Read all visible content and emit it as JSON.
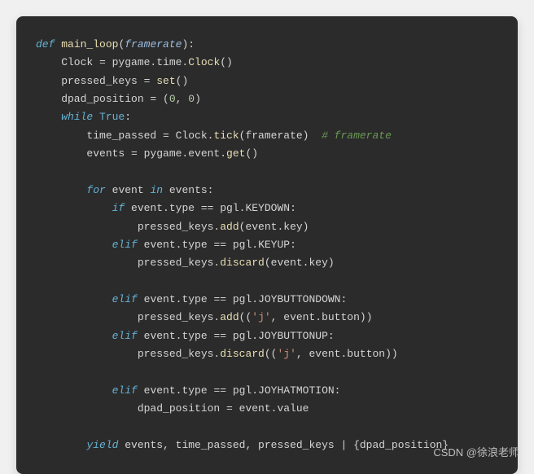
{
  "code": {
    "lines": [
      [
        {
          "t": "def ",
          "c": "kw"
        },
        {
          "t": "main_loop",
          "c": "fn"
        },
        {
          "t": "(",
          "c": "punct"
        },
        {
          "t": "framerate",
          "c": "param"
        },
        {
          "t": "):",
          "c": "punct"
        }
      ],
      [
        {
          "t": "    Clock = pygame.time.",
          "c": "attr"
        },
        {
          "t": "Clock",
          "c": "fn"
        },
        {
          "t": "()",
          "c": "punct"
        }
      ],
      [
        {
          "t": "    pressed_keys = ",
          "c": "attr"
        },
        {
          "t": "set",
          "c": "fn"
        },
        {
          "t": "()",
          "c": "punct"
        }
      ],
      [
        {
          "t": "    dpad_position = (",
          "c": "attr"
        },
        {
          "t": "0",
          "c": "num"
        },
        {
          "t": ", ",
          "c": "punct"
        },
        {
          "t": "0",
          "c": "num"
        },
        {
          "t": ")",
          "c": "punct"
        }
      ],
      [
        {
          "t": "    ",
          "c": "attr"
        },
        {
          "t": "while ",
          "c": "kw"
        },
        {
          "t": "True",
          "c": "bool"
        },
        {
          "t": ":",
          "c": "punct"
        }
      ],
      [
        {
          "t": "        time_passed = Clock.",
          "c": "attr"
        },
        {
          "t": "tick",
          "c": "fn"
        },
        {
          "t": "(framerate)  ",
          "c": "attr"
        },
        {
          "t": "# framerate",
          "c": "cmt"
        }
      ],
      [
        {
          "t": "        events = pygame.event.",
          "c": "attr"
        },
        {
          "t": "get",
          "c": "fn"
        },
        {
          "t": "()",
          "c": "punct"
        }
      ],
      [
        {
          "t": "",
          "c": "attr"
        }
      ],
      [
        {
          "t": "        ",
          "c": "attr"
        },
        {
          "t": "for ",
          "c": "kw"
        },
        {
          "t": "event ",
          "c": "attr"
        },
        {
          "t": "in ",
          "c": "kw"
        },
        {
          "t": "events:",
          "c": "attr"
        }
      ],
      [
        {
          "t": "            ",
          "c": "attr"
        },
        {
          "t": "if ",
          "c": "kw"
        },
        {
          "t": "event.type == pgl.KEYDOWN:",
          "c": "attr"
        }
      ],
      [
        {
          "t": "                pressed_keys.",
          "c": "attr"
        },
        {
          "t": "add",
          "c": "fn"
        },
        {
          "t": "(event.key)",
          "c": "attr"
        }
      ],
      [
        {
          "t": "            ",
          "c": "attr"
        },
        {
          "t": "elif ",
          "c": "kw"
        },
        {
          "t": "event.type == pgl.KEYUP:",
          "c": "attr"
        }
      ],
      [
        {
          "t": "                pressed_keys.",
          "c": "attr"
        },
        {
          "t": "discard",
          "c": "fn"
        },
        {
          "t": "(event.key)",
          "c": "attr"
        }
      ],
      [
        {
          "t": "",
          "c": "attr"
        }
      ],
      [
        {
          "t": "            ",
          "c": "attr"
        },
        {
          "t": "elif ",
          "c": "kw"
        },
        {
          "t": "event.type == pgl.JOYBUTTONDOWN:",
          "c": "attr"
        }
      ],
      [
        {
          "t": "                pressed_keys.",
          "c": "attr"
        },
        {
          "t": "add",
          "c": "fn"
        },
        {
          "t": "((",
          "c": "punct"
        },
        {
          "t": "'j'",
          "c": "str"
        },
        {
          "t": ", event.button))",
          "c": "attr"
        }
      ],
      [
        {
          "t": "            ",
          "c": "attr"
        },
        {
          "t": "elif ",
          "c": "kw"
        },
        {
          "t": "event.type == pgl.JOYBUTTONUP:",
          "c": "attr"
        }
      ],
      [
        {
          "t": "                pressed_keys.",
          "c": "attr"
        },
        {
          "t": "discard",
          "c": "fn"
        },
        {
          "t": "((",
          "c": "punct"
        },
        {
          "t": "'j'",
          "c": "str"
        },
        {
          "t": ", event.button))",
          "c": "attr"
        }
      ],
      [
        {
          "t": "",
          "c": "attr"
        }
      ],
      [
        {
          "t": "            ",
          "c": "attr"
        },
        {
          "t": "elif ",
          "c": "kw"
        },
        {
          "t": "event.type == pgl.JOYHATMOTION:",
          "c": "attr"
        }
      ],
      [
        {
          "t": "                dpad_position = event.value",
          "c": "attr"
        }
      ],
      [
        {
          "t": "",
          "c": "attr"
        }
      ],
      [
        {
          "t": "        ",
          "c": "attr"
        },
        {
          "t": "yield ",
          "c": "kw"
        },
        {
          "t": "events, time_passed, pressed_keys | {dpad_position}",
          "c": "attr"
        }
      ]
    ]
  },
  "watermark": "CSDN @徐浪老师"
}
